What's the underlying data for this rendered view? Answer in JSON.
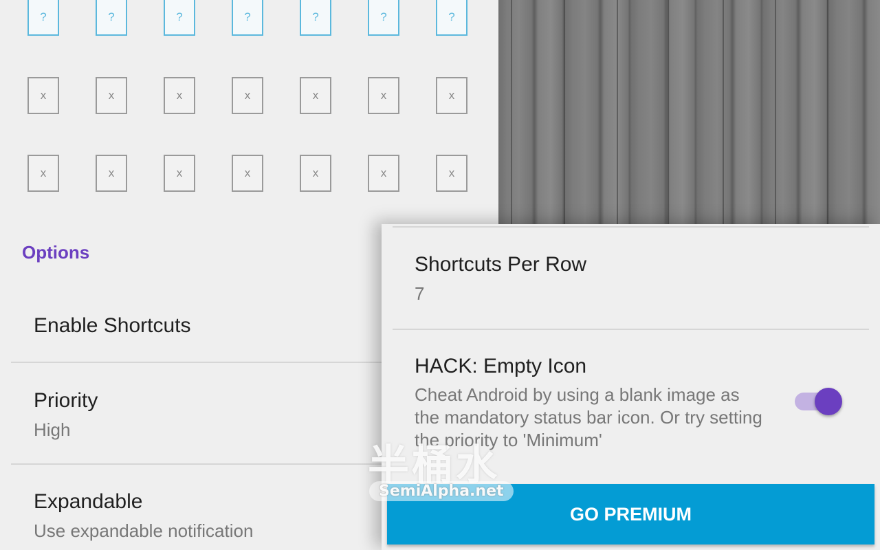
{
  "grid": {
    "rows": [
      {
        "kind": "unknown",
        "glyph": "?",
        "count": 7
      },
      {
        "kind": "empty",
        "glyph": "x",
        "count": 7
      },
      {
        "kind": "empty",
        "glyph": "x",
        "count": 7
      }
    ]
  },
  "options": {
    "header": "Options",
    "enable_shortcuts": {
      "title": "Enable Shortcuts"
    },
    "priority": {
      "title": "Priority",
      "summary": "High"
    },
    "expandable": {
      "title": "Expandable",
      "summary": "Use expandable notification"
    }
  },
  "dialog": {
    "shortcuts_per_row": {
      "title": "Shortcuts Per Row",
      "value": "7"
    },
    "hack_empty_icon": {
      "title": "HACK: Empty Icon",
      "summary": "Cheat Android by using a blank image as the mandatory status bar icon. Or try setting the priority to 'Minimum'",
      "enabled": true
    },
    "premium_button": "GO PREMIUM"
  },
  "watermark": {
    "cn": "半桶水",
    "en": "SemiAlpha.net"
  },
  "colors": {
    "accent": "#6b3fc0",
    "premium": "#049cd4",
    "shortcut_border": "#5bb8dd"
  }
}
